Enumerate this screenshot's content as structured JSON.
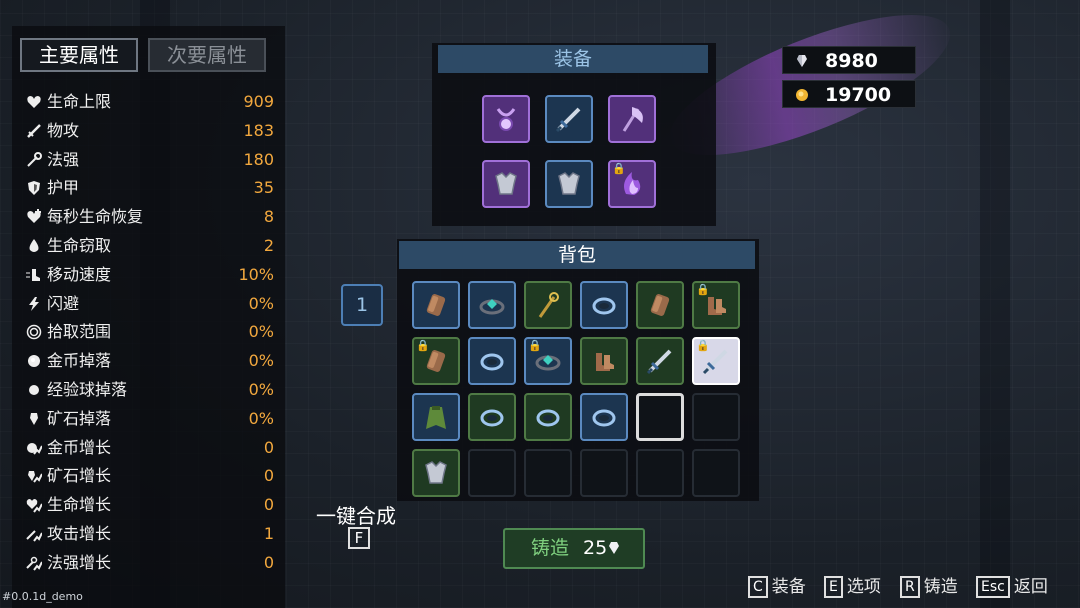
{
  "tabs": {
    "primary": "主要属性",
    "secondary": "次要属性"
  },
  "stats": [
    {
      "name": "生命上限",
      "value": "909",
      "icon": "heart-icon"
    },
    {
      "name": "物攻",
      "value": "183",
      "icon": "sword-icon"
    },
    {
      "name": "法强",
      "value": "180",
      "icon": "wand-icon"
    },
    {
      "name": "护甲",
      "value": "35",
      "icon": "shield-icon"
    },
    {
      "name": "每秒生命恢复",
      "value": "8",
      "icon": "heart-regen-icon"
    },
    {
      "name": "生命窃取",
      "value": "2",
      "icon": "blood-drop-icon"
    },
    {
      "name": "移动速度",
      "value": "10%",
      "icon": "boot-speed-icon"
    },
    {
      "name": "闪避",
      "value": "0%",
      "icon": "lightning-icon"
    },
    {
      "name": "拾取范围",
      "value": "0%",
      "icon": "ring-target-icon"
    },
    {
      "name": "金币掉落",
      "value": "0%",
      "icon": "coin-icon"
    },
    {
      "name": "经验球掉落",
      "value": "0%",
      "icon": "orb-icon"
    },
    {
      "name": "矿石掉落",
      "value": "0%",
      "icon": "ore-icon"
    },
    {
      "name": "金币增长",
      "value": "0",
      "icon": "coin-growth-icon"
    },
    {
      "name": "矿石增长",
      "value": "0",
      "icon": "ore-growth-icon"
    },
    {
      "name": "生命增长",
      "value": "0",
      "icon": "life-growth-icon"
    },
    {
      "name": "攻击增长",
      "value": "1",
      "icon": "attack-growth-icon"
    },
    {
      "name": "法强增长",
      "value": "0",
      "icon": "magic-growth-icon"
    }
  ],
  "equipment": {
    "title": "装备",
    "slots": [
      {
        "item": "amulet",
        "rarity": "purple",
        "locked": false
      },
      {
        "item": "sword",
        "rarity": "blue",
        "locked": false
      },
      {
        "item": "axe",
        "rarity": "purple",
        "locked": false
      },
      {
        "item": "armor",
        "rarity": "purple",
        "locked": false
      },
      {
        "item": "armor",
        "rarity": "blue",
        "locked": false
      },
      {
        "item": "flame-tome",
        "rarity": "purple",
        "locked": true
      }
    ]
  },
  "bag": {
    "title": "背包",
    "page": "1",
    "slots": [
      {
        "item": "bracer",
        "rarity": "blue",
        "locked": false
      },
      {
        "item": "gem-ring",
        "rarity": "blue",
        "locked": false
      },
      {
        "item": "staff",
        "rarity": "green",
        "locked": false
      },
      {
        "item": "ring",
        "rarity": "blue",
        "locked": false
      },
      {
        "item": "bracer",
        "rarity": "green",
        "locked": false
      },
      {
        "item": "boots",
        "rarity": "green",
        "locked": true
      },
      {
        "item": "bracer",
        "rarity": "green",
        "locked": true
      },
      {
        "item": "ring",
        "rarity": "blue",
        "locked": false
      },
      {
        "item": "gem-ring",
        "rarity": "blue",
        "locked": true
      },
      {
        "item": "boots",
        "rarity": "green",
        "locked": false
      },
      {
        "item": "sword",
        "rarity": "green",
        "locked": false
      },
      {
        "item": "sword",
        "rarity": "glow",
        "locked": true
      },
      {
        "item": "cloak",
        "rarity": "blue",
        "locked": false
      },
      {
        "item": "ring",
        "rarity": "green",
        "locked": false
      },
      {
        "item": "ring",
        "rarity": "green",
        "locked": false
      },
      {
        "item": "ring",
        "rarity": "blue",
        "locked": false
      },
      {
        "item": "",
        "rarity": "selected",
        "locked": false
      },
      {
        "item": "",
        "rarity": "empty",
        "locked": false
      },
      {
        "item": "armor",
        "rarity": "green",
        "locked": false
      },
      {
        "item": "",
        "rarity": "empty",
        "locked": false
      },
      {
        "item": "",
        "rarity": "empty",
        "locked": false
      },
      {
        "item": "",
        "rarity": "empty",
        "locked": false
      },
      {
        "item": "",
        "rarity": "empty",
        "locked": false
      },
      {
        "item": "",
        "rarity": "empty",
        "locked": false
      }
    ]
  },
  "craft_all": {
    "label": "一键合成",
    "key": "F"
  },
  "forge": {
    "label": "铸造",
    "cost": "25"
  },
  "currency": {
    "gems": "8980",
    "gold": "19700"
  },
  "hints": [
    {
      "key": "C",
      "label": "装备"
    },
    {
      "key": "E",
      "label": "选项"
    },
    {
      "key": "R",
      "label": "铸造"
    },
    {
      "key": "Esc",
      "label": "返回"
    }
  ],
  "version": "#0.0.1d_demo",
  "colors": {
    "stat_value": "#f2a83e",
    "panel_title": "#2d4a66",
    "rarity_purple": "#a070d8",
    "rarity_blue": "#5b8ac0",
    "rarity_green": "#4f7a45"
  }
}
